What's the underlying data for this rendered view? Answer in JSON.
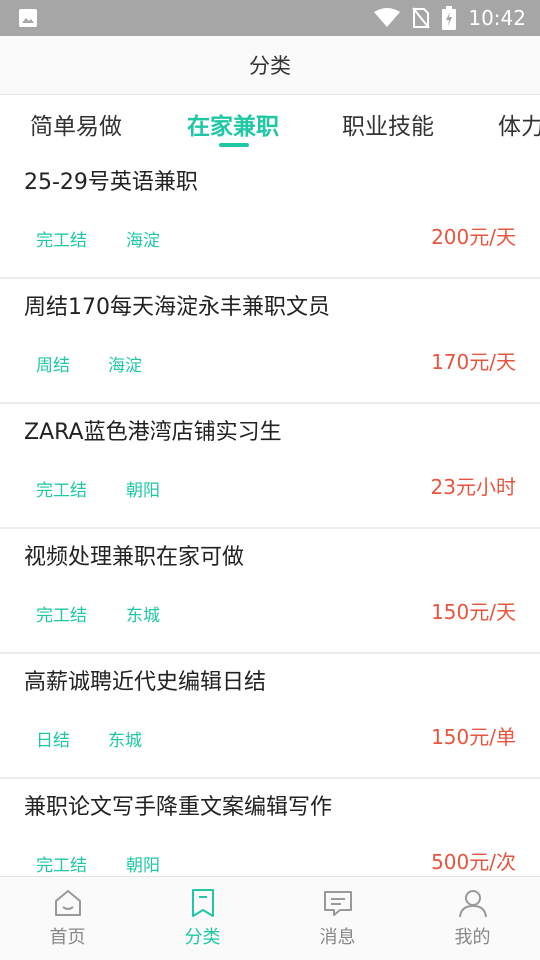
{
  "status_bar": {
    "time": "10:42",
    "icons": [
      "image-icon",
      "wifi-icon",
      "no-sim-icon",
      "battery-charging-icon"
    ]
  },
  "header": {
    "title": "分类"
  },
  "tabs": [
    {
      "label": "简单易做",
      "active": false
    },
    {
      "label": "在家兼职",
      "active": true
    },
    {
      "label": "职业技能",
      "active": false
    },
    {
      "label": "体力",
      "active": false
    }
  ],
  "jobs": [
    {
      "title": "25-29号英语兼职",
      "tags": [
        "完工结",
        "海淀"
      ],
      "pay": "200元/天"
    },
    {
      "title": "周结170每天海淀永丰兼职文员",
      "tags": [
        "周结",
        "海淀"
      ],
      "pay": "170元/天"
    },
    {
      "title": "ZARA蓝色港湾店铺实习生",
      "tags": [
        "完工结",
        "朝阳"
      ],
      "pay": "23元小时"
    },
    {
      "title": "视频处理兼职在家可做",
      "tags": [
        "完工结",
        "东城"
      ],
      "pay": "150元/天"
    },
    {
      "title": "高薪诚聘近代史编辑日结",
      "tags": [
        "日结",
        "东城"
      ],
      "pay": "150元/单"
    },
    {
      "title": "兼职论文写手降重文案编辑写作",
      "tags": [
        "完工结",
        "朝阳"
      ],
      "pay": "500元/次"
    }
  ],
  "bottom_nav": [
    {
      "label": "首页",
      "icon": "home-icon",
      "active": false
    },
    {
      "label": "分类",
      "icon": "bookmark-icon",
      "active": true
    },
    {
      "label": "消息",
      "icon": "message-icon",
      "active": false
    },
    {
      "label": "我的",
      "icon": "user-icon",
      "active": false
    }
  ],
  "colors": {
    "accent": "#1fc7a5",
    "pay": "#e8553e",
    "status_bar": "#a6a6a6"
  }
}
